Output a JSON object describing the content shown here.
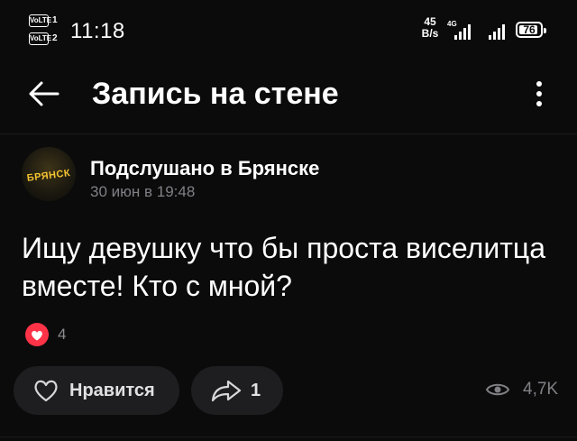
{
  "status_bar": {
    "sim1": {
      "tag": "VoLTE",
      "num": "1"
    },
    "sim2": {
      "tag": "VoLTE",
      "num": "2"
    },
    "time": "11:18",
    "net_speed_value": "45",
    "net_speed_unit": "B/s",
    "network_type": "4G",
    "battery": "76"
  },
  "header": {
    "title": "Запись на стене"
  },
  "post": {
    "author": "Подслушано в Брянске",
    "avatar_text": "БРЯНСК",
    "date": "30 июн в 19:48",
    "text": "Ищу девушку что бы проста виселитца вместе! Кто с мной?",
    "reaction_count": "4"
  },
  "actions": {
    "like_label": "Нравится",
    "share_count": "1",
    "views": "4,7K"
  },
  "colors": {
    "background": "#0b0b0c",
    "button_bg": "#1e1e20",
    "reaction_red": "#ff3347",
    "muted_text": "#808085"
  }
}
